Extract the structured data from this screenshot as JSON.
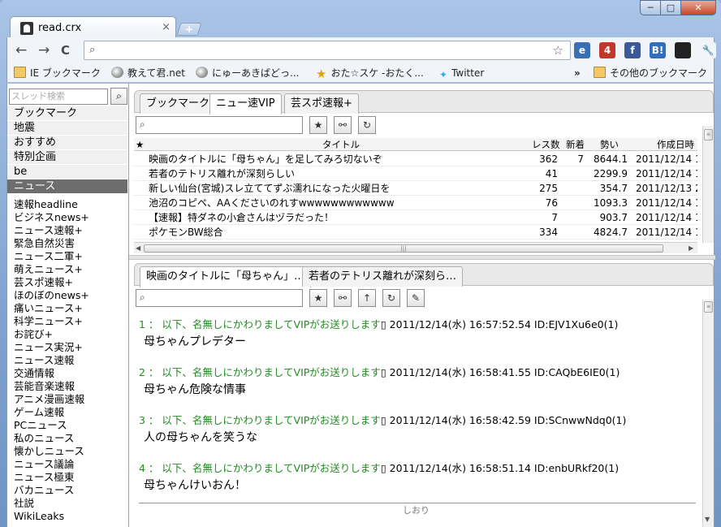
{
  "window": {
    "tab_title": "read.crx",
    "tab_close": "×",
    "newtab": "+",
    "min": "─",
    "max": "□",
    "close": "✕"
  },
  "toolbar": {
    "back": "←",
    "forward": "→",
    "reload": "C",
    "search_glyph": "⌕",
    "address_value": "",
    "omni_right": "☆",
    "icons": [
      {
        "name": "ie-tab-icon",
        "label": "e",
        "color": "#3a6fb5"
      },
      {
        "name": "extension-badge-icon",
        "label": "4",
        "color": "#c0392b"
      },
      {
        "name": "facebook-icon",
        "label": "f",
        "color": "#3b5998"
      },
      {
        "name": "hatena-bookmark-icon",
        "label": "B!",
        "color": "#2f6ec1"
      },
      {
        "name": "readcrx-icon",
        "label": "",
        "color": "#222222"
      },
      {
        "name": "wrench-icon",
        "label": "🔧",
        "color": "#f1f4f9"
      }
    ]
  },
  "bookmarks": {
    "items": [
      "IE ブックマーク",
      "教えて君.net",
      "にゅーあきばどっ...",
      "おた☆スケ -おたく...",
      "Twitter"
    ],
    "overflow": "»",
    "other": "その他のブックマーク"
  },
  "left": {
    "search_placeholder": "スレッド検索",
    "search_btn": "⌕",
    "categories": [
      "ブックマーク",
      "地震",
      "おすすめ",
      "特別企画",
      "be",
      "ニュース"
    ],
    "active_category": "ニュース",
    "boards": [
      "速報headline",
      "ビジネスnews+",
      "ニュース速報+",
      "緊急自然災害",
      "ニュース二軍+",
      "萌えニュース+",
      "芸スポ速報+",
      "ほのぼのnews+",
      "痛いニュース+",
      "科学ニュース+",
      "お詫び+",
      "ニュース実況+",
      "ニュース速報",
      "交通情報",
      "芸能音楽速報",
      "アニメ漫画速報",
      "ゲーム速報",
      "PCニュース",
      "私のニュース",
      "懐かしニュース",
      "ニュース議論",
      "ニュース極東",
      "バカニュース",
      "社説",
      "WikiLeaks"
    ]
  },
  "upper": {
    "tabs": [
      "ブックマーク",
      "ニュー速VIP",
      "芸スポ速報+"
    ],
    "selected_tab": "ニュー速VIP",
    "columns": {
      "star": "★",
      "title": "タイトル",
      "res": "レス数",
      "new": "新着",
      "momentum": "勢い",
      "created": "作成日時"
    },
    "rows": [
      {
        "title": "映画のタイトルに「母ちゃん」を足してみろ切ないぞ",
        "res": "362",
        "new": "7",
        "momentum": "8644.1",
        "created": "2011/12/14 1"
      },
      {
        "title": "若者のテトリス離れが深刻らしい",
        "res": "41",
        "new": "",
        "momentum": "2299.9",
        "created": "2011/12/14 1"
      },
      {
        "title": "新しい仙台(宮城)スレ立ててずぶ濡れになった火曜日を",
        "res": "275",
        "new": "",
        "momentum": "354.7",
        "created": "2011/12/13 2"
      },
      {
        "title": "池沼のコピペ、AAくださいのれすwwwwwwwwwwww",
        "res": "76",
        "new": "",
        "momentum": "1093.3",
        "created": "2011/12/14 1"
      },
      {
        "title": "【速報】特ダネの小倉さんはヅラだった！",
        "res": "7",
        "new": "",
        "momentum": "903.7",
        "created": "2011/12/14 1"
      },
      {
        "title": "ポケモンBW総合",
        "res": "334",
        "new": "",
        "momentum": "4824.7",
        "created": "2011/12/14 1"
      }
    ],
    "hscroll_grip": "|||"
  },
  "lower": {
    "tabs": [
      "映画のタイトルに「母ちゃん」…",
      "若者のテトリス離れが深刻ら…"
    ],
    "selected_tab": "映画のタイトルに「母ちゃん」…",
    "posts": [
      {
        "num": "1",
        "name": "以下、名無しにかわりましてVIPがお送りします",
        "meta": "▯ 2011/12/14(水) 16:57:52.54 ID:EJV1Xu6e0(1)",
        "body": "母ちゃんプレデター"
      },
      {
        "num": "2",
        "name": "以下、名無しにかわりましてVIPがお送りします",
        "meta": "▯ 2011/12/14(水) 16:58:41.55 ID:CAQbE6IE0(1)",
        "body": "母ちゃん危険な情事"
      },
      {
        "num": "3",
        "name": "以下、名無しにかわりましてVIPがお送りします",
        "meta": "▯ 2011/12/14(水) 16:58:42.59 ID:SCnwwNdq0(1)",
        "body": "人の母ちゃんを笑うな"
      },
      {
        "num": "4",
        "name": "以下、名無しにかわりましてVIPがお送りします",
        "meta": "▯ 2011/12/14(水) 16:58:51.14 ID:enbURkf20(1)",
        "body": "母ちゃんけいおん！"
      }
    ],
    "bookmark_label": "しおり"
  }
}
